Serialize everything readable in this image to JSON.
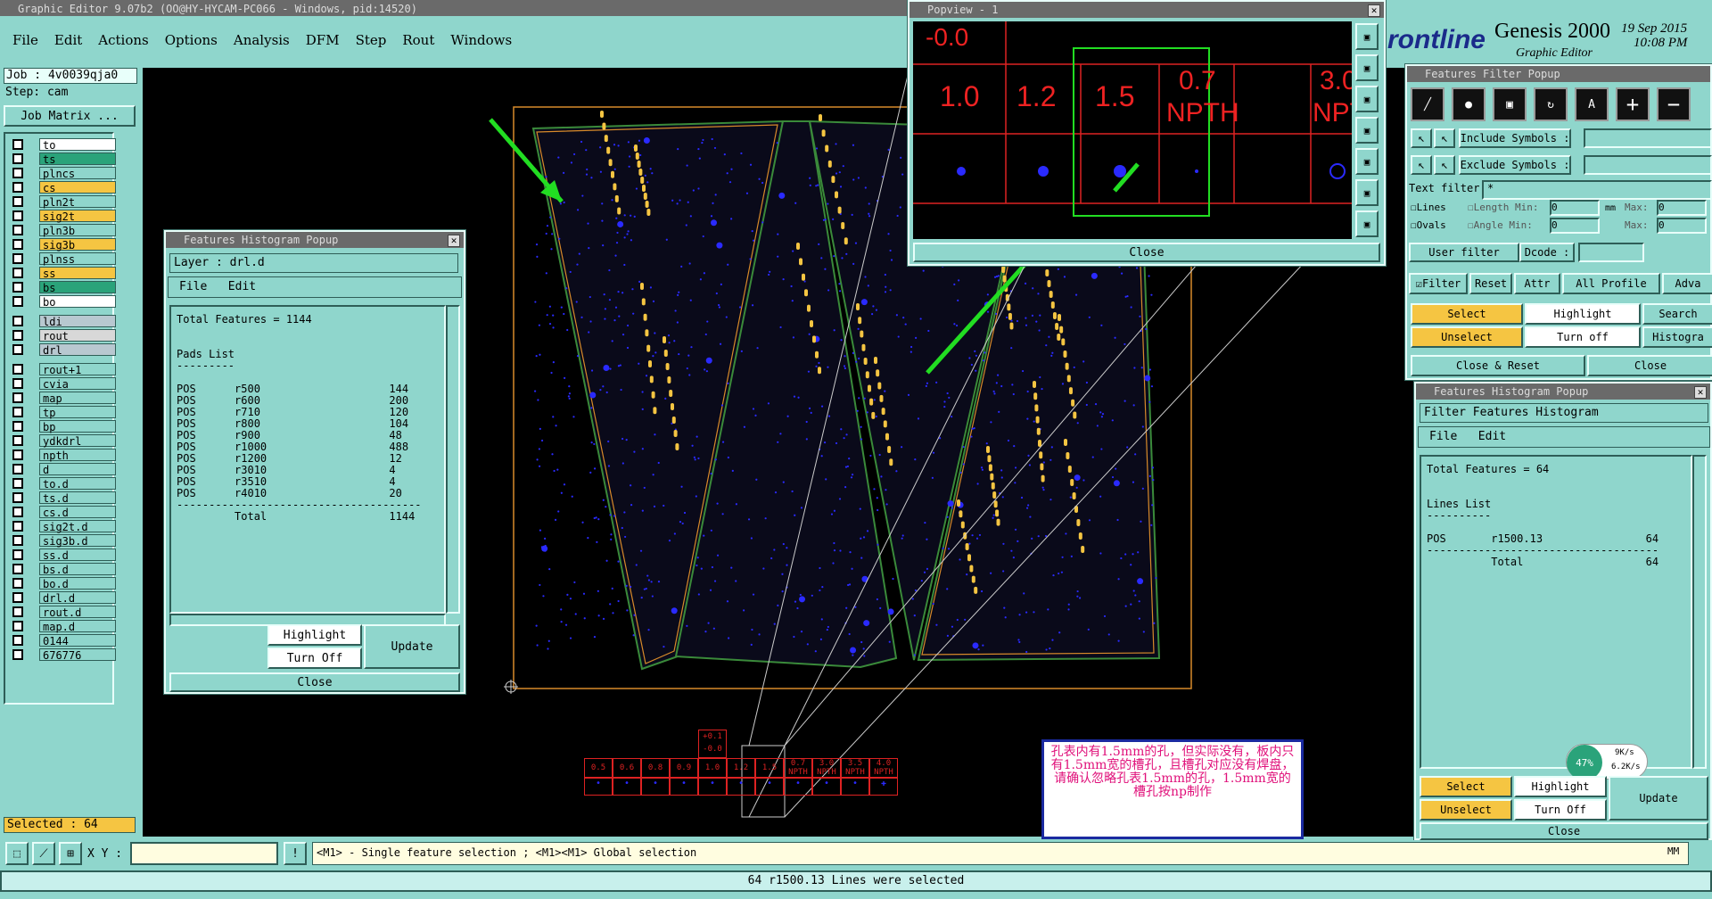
{
  "app": {
    "title": "Graphic Editor 9.07b2 (OO@HY-HYCAM-PC066 - Windows, pid:14520)"
  },
  "menu": [
    "File",
    "Edit",
    "Actions",
    "Options",
    "Analysis",
    "DFM",
    "Step",
    "Rout",
    "Windows"
  ],
  "job": {
    "job_label": "Job : 4v0039qja0",
    "step_label": "Step: cam",
    "matrix_button": "Job Matrix ..."
  },
  "layers": [
    {
      "name": "to",
      "color": "#ffffff"
    },
    {
      "name": "ts",
      "color": "#2aa37a"
    },
    {
      "name": "plncs",
      "color": "#8fd6cc"
    },
    {
      "name": "cs",
      "color": "#f5c542"
    },
    {
      "name": "pln2t",
      "color": "#8fd6cc"
    },
    {
      "name": "sig2t",
      "color": "#f5c542"
    },
    {
      "name": "pln3b",
      "color": "#8fd6cc"
    },
    {
      "name": "sig3b",
      "color": "#f5c542"
    },
    {
      "name": "plnss",
      "color": "#8fd6cc"
    },
    {
      "name": "ss",
      "color": "#f5c542"
    },
    {
      "name": "bs",
      "color": "#2aa37a"
    },
    {
      "name": "bo",
      "color": "#ffffff"
    },
    {
      "name": "ldi",
      "color": "#b8c8d0"
    },
    {
      "name": "rout",
      "color": "#d8d8d8"
    },
    {
      "name": "drl",
      "color": "#b8c8d0"
    },
    {
      "name": "rout+1",
      "color": "#8fd6cc"
    },
    {
      "name": "cvia",
      "color": "#8fd6cc"
    },
    {
      "name": "map",
      "color": "#8fd6cc"
    },
    {
      "name": "tp",
      "color": "#8fd6cc"
    },
    {
      "name": "bp",
      "color": "#8fd6cc"
    },
    {
      "name": "ydkdrl",
      "color": "#8fd6cc"
    },
    {
      "name": "npth",
      "color": "#8fd6cc"
    },
    {
      "name": "d",
      "color": "#8fd6cc"
    },
    {
      "name": "to.d",
      "color": "#8fd6cc"
    },
    {
      "name": "ts.d",
      "color": "#8fd6cc"
    },
    {
      "name": "cs.d",
      "color": "#8fd6cc"
    },
    {
      "name": "sig2t.d",
      "color": "#8fd6cc"
    },
    {
      "name": "sig3b.d",
      "color": "#8fd6cc"
    },
    {
      "name": "ss.d",
      "color": "#8fd6cc"
    },
    {
      "name": "bs.d",
      "color": "#8fd6cc"
    },
    {
      "name": "bo.d",
      "color": "#8fd6cc"
    },
    {
      "name": "drl.d",
      "color": "#8fd6cc"
    },
    {
      "name": "rout.d",
      "color": "#8fd6cc"
    },
    {
      "name": "map.d",
      "color": "#8fd6cc"
    },
    {
      "name": "0144",
      "color": "#8fd6cc"
    },
    {
      "name": "676776",
      "color": "#8fd6cc"
    }
  ],
  "selected_count": "Selected : 64",
  "hist1": {
    "title": "Features Histogram Popup",
    "layer": "Layer :  drl.d",
    "menu": [
      "File",
      "Edit"
    ],
    "text": "Total Features = 1144\n\n\nPads List\n---------\n\nPOS      r500                    144\nPOS      r600                    200\nPOS      r710                    120\nPOS      r800                    104\nPOS      r900                    48\nPOS      r1000                   488\nPOS      r1200                   12\nPOS      r3010                   4\nPOS      r3510                   4\nPOS      r4010                   20\n--------------------------------------\n         Total                   1144",
    "highlight": "Highlight",
    "turn_off": "Turn Off",
    "update": "Update",
    "close": "Close"
  },
  "popview": {
    "title": "Popview - 1",
    "top": "-0.0",
    "cols": [
      "1.0",
      "1.2",
      "1.5",
      "0.7",
      "3.0"
    ],
    "sub": [
      "",
      "",
      "",
      "NPTH",
      "NPT"
    ],
    "close": "Close"
  },
  "genesis": {
    "brand": "rontline",
    "product": "Genesis 2000",
    "subtitle": "Graphic Editor",
    "date": "19 Sep 2015",
    "time": "10:08 PM"
  },
  "filter": {
    "title": "Features Filter Popup",
    "include": "Include Symbols :",
    "exclude": "Exclude Symbols :",
    "text_filter": "Text filter",
    "text_value": "*",
    "lines": "Lines",
    "ovals": "Ovals",
    "length": "Length",
    "angle": "Angle",
    "min": "Min:",
    "max": "Max:",
    "min_val": "0",
    "max_val": "0",
    "mm": "mm",
    "user_filter": "User filter",
    "dcode": "Dcode :",
    "filter_btn": "Filter",
    "reset": "Reset",
    "attr": "Attr",
    "all_profile": "All Profile",
    "adv": "Adva",
    "select": "Select",
    "highlight": "Highlight",
    "search": "Search",
    "unselect": "Unselect",
    "turn_off": "Turn off",
    "histogram": "Histogra",
    "close_reset": "Close & Reset",
    "close": "Close"
  },
  "hist2": {
    "title": "Features Histogram Popup",
    "header": "Filter Features Histogram",
    "menu": [
      "File",
      "Edit"
    ],
    "text": "Total Features = 64\n\n\nLines List\n----------\n\nPOS       r1500.13                64\n------------------------------------\n          Total                   64",
    "select": "Select",
    "highlight": "Highlight",
    "unselect": "Unselect",
    "turn_off": "Turn Off",
    "update": "Update",
    "close": "Close"
  },
  "net": {
    "pct": "47%",
    "up": "9K/s",
    "down": "6.2K/s"
  },
  "table": {
    "top": [
      "+0.1",
      "-0.0"
    ],
    "cols": [
      "0.5",
      "0.6",
      "0.8",
      "0.9",
      "1.0",
      "1.2",
      "1.5",
      "0.7\nNPTH",
      "3.0\nNPTH",
      "3.5\nNPTH",
      "4.0\nNPTH"
    ]
  },
  "note": "孔表内有1.5mm的孔，但实际没有，板内只有1.5mm宽的槽孔，且槽孔对应没有焊盘，请确认忽略孔表1.5mm的孔，1.5mm宽的槽孔按np制作",
  "status": {
    "xy_label": "X Y :",
    "hint": "<M1> - Single feature selection ; <M1><M1> Global selection",
    "message": "64 r1500.13 Lines were selected",
    "units": "MM"
  },
  "colors": {
    "teal": "#8fd6cc",
    "canvas": "#000000",
    "profile": "#d88a2a",
    "slot": "#f5c542",
    "arrow": "#22dd22",
    "pad": "#2a2aff",
    "note_text": "#e0107a"
  }
}
